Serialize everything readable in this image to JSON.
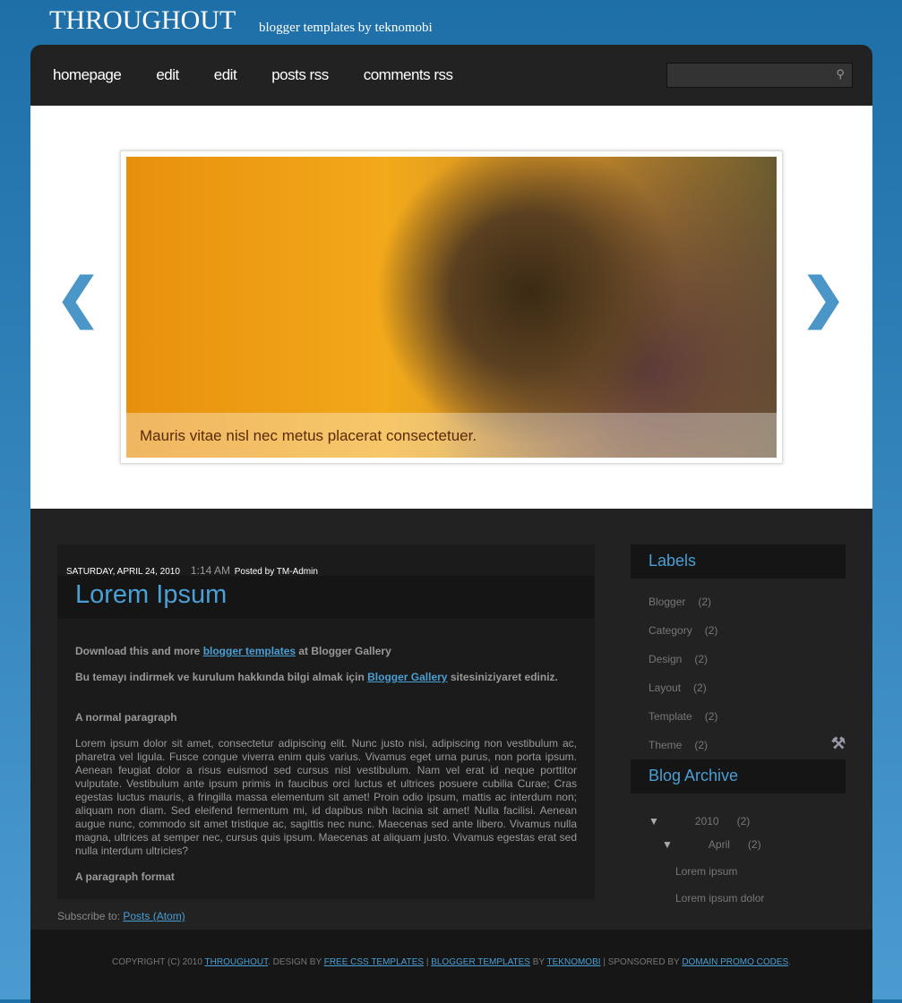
{
  "header": {
    "title": "THROUGHOUT",
    "subtitle": "blogger templates by teknomobi"
  },
  "nav": {
    "items": [
      "homepage",
      "edit",
      "edit",
      "posts rss",
      "comments rss"
    ],
    "search_placeholder": ""
  },
  "slider": {
    "caption": "Mauris vitae nisl nec metus placerat consectetuer."
  },
  "post": {
    "date": "SATURDAY, APRIL 24, 2010",
    "time": "1:14 AM",
    "author": "Posted by TM-Admin",
    "title": "Lorem Ipsum",
    "p1_pre": "Download this and more ",
    "p1_link": "blogger templates",
    "p1_post": " at Blogger Gallery",
    "p2_pre": "Bu temayı indirmek ve kurulum hakkında bilgi almak için ",
    "p2_link": "Blogger Gallery",
    "p2_post": " sitesiniziyaret ediniz.",
    "h1": "A normal paragraph",
    "lorem": "Lorem ipsum dolor sit amet, consectetur adipiscing elit. Nunc justo nisi, adipiscing non vestibulum ac, pharetra vel ligula. Fusce congue viverra enim quis varius. Vivamus eget urna purus, non porta ipsum. Aenean feugiat dolor a risus euismod sed cursus nisl vestibulum. Nam vel erat id neque porttitor vulputate. Vestibulum ante ipsum primis in faucibus orci luctus et ultrices posuere cubilia Curae; Cras egestas luctus mauris, a fringilla massa elementum sit amet! Proin odio ipsum, mattis ac interdum non; aliquam non diam. Sed eleifend fermentum mi, id dapibus nibh lacinia sit amet! Nulla facilisi. Aenean augue nunc, commodo sit amet tristique ac, sagittis nec nunc. Maecenas sed ante libero. Vivamus nulla magna, ultrices at semper nec, cursus quis ipsum. Maecenas at aliquam justo. Vivamus egestas erat sed nulla interdum ultricies?",
    "h2": "A paragraph format"
  },
  "subscribe": {
    "label": "Subscribe to: ",
    "link": "Posts (Atom)"
  },
  "labels": {
    "title": "Labels",
    "items": [
      {
        "name": "Blogger",
        "count": "(2)"
      },
      {
        "name": "Category",
        "count": "(2)"
      },
      {
        "name": "Design",
        "count": "(2)"
      },
      {
        "name": "Layout",
        "count": "(2)"
      },
      {
        "name": "Template",
        "count": "(2)"
      },
      {
        "name": "Theme",
        "count": "(2)"
      }
    ]
  },
  "archive": {
    "title": "Blog Archive",
    "year": "2010",
    "year_count": "(2)",
    "month": "April",
    "month_count": "(2)",
    "posts": [
      "Lorem ipsum",
      "Lorem ipsum dolor"
    ]
  },
  "footer": {
    "t1": "COPYRIGHT (C) 2010 ",
    "l1": "THROUGHOUT",
    "t2": ". DESIGN BY ",
    "l2": "FREE CSS TEMPLATES",
    "t3": " | ",
    "l3": "BLOGGER TEMPLATES",
    "t4": " BY ",
    "l4": "TEKNOMOBI",
    "t5": " | SPONSORED BY ",
    "l5": "DOMAIN PROMO CODES",
    "t6": "."
  }
}
